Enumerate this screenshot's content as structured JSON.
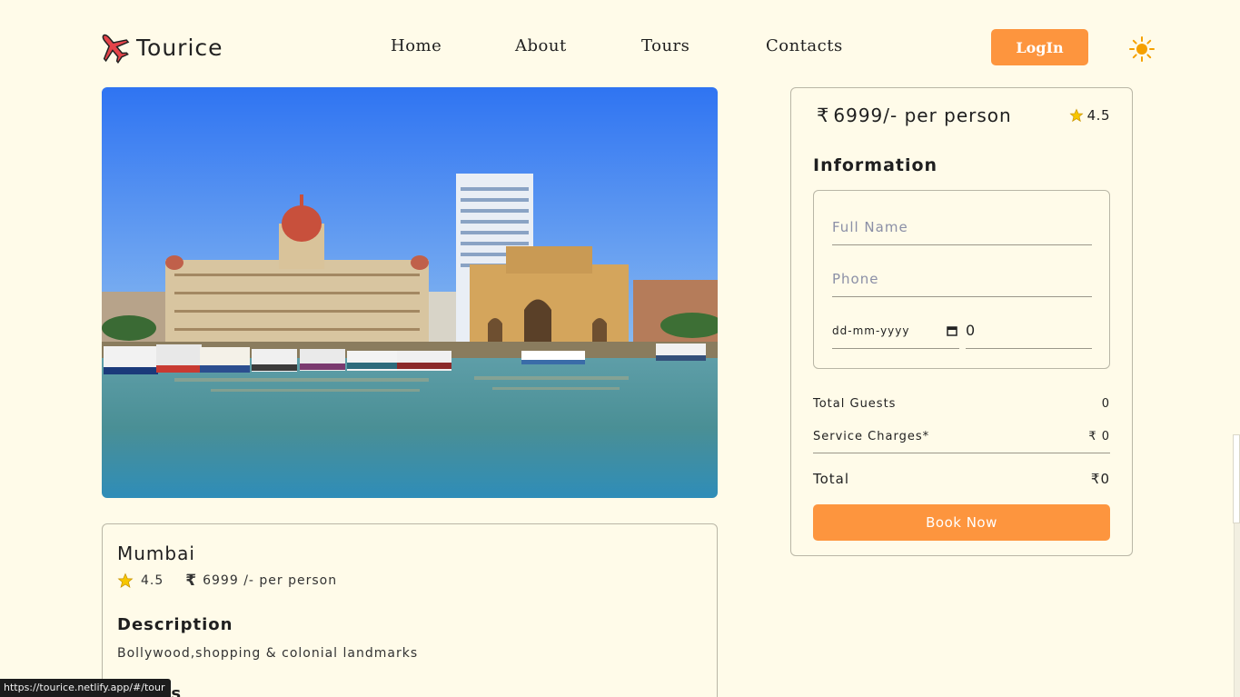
{
  "brand": {
    "name": "Tourice"
  },
  "nav": {
    "items": [
      "Home",
      "About",
      "Tours",
      "Contacts"
    ]
  },
  "header": {
    "login_label": "LogIn"
  },
  "tour": {
    "city": "Mumbai",
    "rating": "4.5",
    "price_text": "6999 /- per person",
    "description_title": "Description",
    "description": "Bollywood,shopping & colonial landmarks",
    "places_title": "Places"
  },
  "booking": {
    "price_text": "6999/- per person",
    "rating": "4.5",
    "info_title": "Information",
    "fullname_placeholder": "Full Name",
    "phone_placeholder": "Phone",
    "date_placeholder": "dd-mm-yyyy",
    "guests_value": "0",
    "total_guests_label": "Total Guests",
    "total_guests_value": "0",
    "service_label": "Service Charges*",
    "service_value": "₹ 0",
    "total_label": "Total",
    "total_value": "₹0",
    "book_label": "Book Now"
  },
  "status_bar": {
    "url": "https://tourice.netlify.app/#/tour"
  },
  "colors": {
    "accent": "#fd953e",
    "background": "#fffbe9",
    "star": "#f7c600"
  },
  "icons": [
    "airplane-logo-icon",
    "sun-icon",
    "star-icon",
    "rupee-icon",
    "calendar-icon"
  ]
}
